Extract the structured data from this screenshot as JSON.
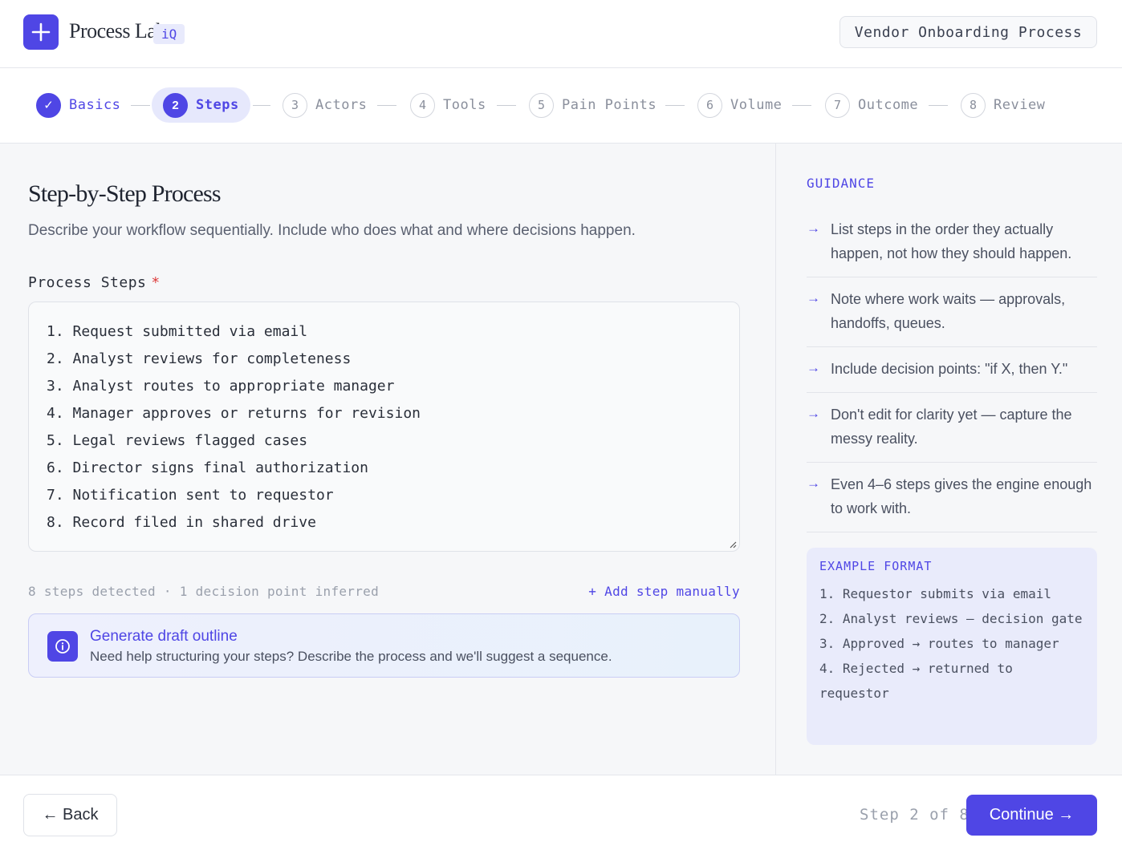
{
  "header": {
    "brand_name": "Process Lab",
    "brand_badge": "iQ",
    "process_name": "Vendor Onboarding Process"
  },
  "stepper": {
    "steps": [
      {
        "number": "✓",
        "label": "Basics",
        "state": "done"
      },
      {
        "number": "2",
        "label": "Steps",
        "state": "active"
      },
      {
        "number": "3",
        "label": "Actors",
        "state": "pending"
      },
      {
        "number": "4",
        "label": "Tools",
        "state": "pending"
      },
      {
        "number": "5",
        "label": "Pain Points",
        "state": "pending"
      },
      {
        "number": "6",
        "label": "Volume",
        "state": "pending"
      },
      {
        "number": "7",
        "label": "Outcome",
        "state": "pending"
      },
      {
        "number": "8",
        "label": "Review",
        "state": "pending"
      }
    ]
  },
  "main": {
    "title": "Step-by-Step Process",
    "subtitle": "Describe your workflow sequentially. Include who does what and where decisions happen.",
    "field_label": "Process Steps",
    "required_mark": "*",
    "steps_text": [
      "1. Request submitted via email",
      "2. Analyst reviews for completeness",
      "3. Analyst routes to appropriate manager",
      "4. Manager approves or returns for revision",
      "5. Legal reviews flagged cases",
      "6. Director signs final authorization",
      "7. Notification sent to requestor",
      "8. Record filed in shared drive"
    ],
    "meta_text": "8 steps detected · 1 decision point inferred",
    "add_step_label": "+ Add step manually",
    "callout": {
      "title": "Generate draft outline",
      "text": "Need help structuring your steps? Describe the process and we'll suggest a sequence."
    }
  },
  "guidance": {
    "heading": "GUIDANCE",
    "arrow_glyph": "→",
    "items": [
      "List steps in the order they actually happen, not how they should happen.",
      "Note where work waits — approvals, handoffs, queues.",
      "Include decision points: \"if X, then Y.\"",
      "Don't edit for clarity yet — capture the messy reality.",
      "Even 4–6 steps gives the engine enough to work with."
    ],
    "example": {
      "heading": "EXAMPLE FORMAT",
      "lines": [
        "1. Requestor submits via email",
        "2. Analyst reviews — decision gate",
        "3. Approved → routes to manager",
        "4. Rejected → returned to requestor"
      ]
    }
  },
  "footer": {
    "back_label": "← Back",
    "step_indicator": "Step 2 of 8",
    "continue_label": "Continue →"
  },
  "colors": {
    "accent": "#4f46e5",
    "required": "#dc3b3b"
  }
}
